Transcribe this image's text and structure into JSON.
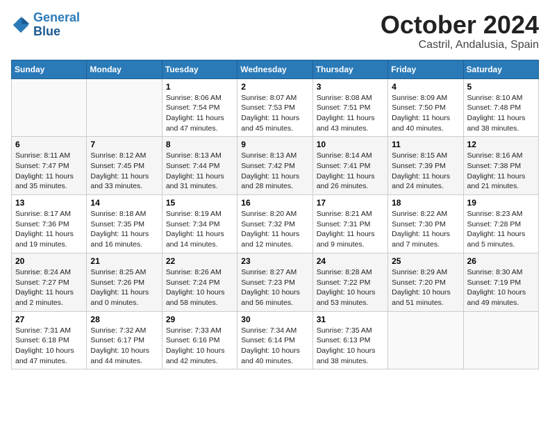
{
  "header": {
    "logo_line1": "General",
    "logo_line2": "Blue",
    "month": "October 2024",
    "location": "Castril, Andalusia, Spain"
  },
  "weekdays": [
    "Sunday",
    "Monday",
    "Tuesday",
    "Wednesday",
    "Thursday",
    "Friday",
    "Saturday"
  ],
  "weeks": [
    [
      {
        "day": "",
        "info": ""
      },
      {
        "day": "",
        "info": ""
      },
      {
        "day": "1",
        "info": "Sunrise: 8:06 AM\nSunset: 7:54 PM\nDaylight: 11 hours and 47 minutes."
      },
      {
        "day": "2",
        "info": "Sunrise: 8:07 AM\nSunset: 7:53 PM\nDaylight: 11 hours and 45 minutes."
      },
      {
        "day": "3",
        "info": "Sunrise: 8:08 AM\nSunset: 7:51 PM\nDaylight: 11 hours and 43 minutes."
      },
      {
        "day": "4",
        "info": "Sunrise: 8:09 AM\nSunset: 7:50 PM\nDaylight: 11 hours and 40 minutes."
      },
      {
        "day": "5",
        "info": "Sunrise: 8:10 AM\nSunset: 7:48 PM\nDaylight: 11 hours and 38 minutes."
      }
    ],
    [
      {
        "day": "6",
        "info": "Sunrise: 8:11 AM\nSunset: 7:47 PM\nDaylight: 11 hours and 35 minutes."
      },
      {
        "day": "7",
        "info": "Sunrise: 8:12 AM\nSunset: 7:45 PM\nDaylight: 11 hours and 33 minutes."
      },
      {
        "day": "8",
        "info": "Sunrise: 8:13 AM\nSunset: 7:44 PM\nDaylight: 11 hours and 31 minutes."
      },
      {
        "day": "9",
        "info": "Sunrise: 8:13 AM\nSunset: 7:42 PM\nDaylight: 11 hours and 28 minutes."
      },
      {
        "day": "10",
        "info": "Sunrise: 8:14 AM\nSunset: 7:41 PM\nDaylight: 11 hours and 26 minutes."
      },
      {
        "day": "11",
        "info": "Sunrise: 8:15 AM\nSunset: 7:39 PM\nDaylight: 11 hours and 24 minutes."
      },
      {
        "day": "12",
        "info": "Sunrise: 8:16 AM\nSunset: 7:38 PM\nDaylight: 11 hours and 21 minutes."
      }
    ],
    [
      {
        "day": "13",
        "info": "Sunrise: 8:17 AM\nSunset: 7:36 PM\nDaylight: 11 hours and 19 minutes."
      },
      {
        "day": "14",
        "info": "Sunrise: 8:18 AM\nSunset: 7:35 PM\nDaylight: 11 hours and 16 minutes."
      },
      {
        "day": "15",
        "info": "Sunrise: 8:19 AM\nSunset: 7:34 PM\nDaylight: 11 hours and 14 minutes."
      },
      {
        "day": "16",
        "info": "Sunrise: 8:20 AM\nSunset: 7:32 PM\nDaylight: 11 hours and 12 minutes."
      },
      {
        "day": "17",
        "info": "Sunrise: 8:21 AM\nSunset: 7:31 PM\nDaylight: 11 hours and 9 minutes."
      },
      {
        "day": "18",
        "info": "Sunrise: 8:22 AM\nSunset: 7:30 PM\nDaylight: 11 hours and 7 minutes."
      },
      {
        "day": "19",
        "info": "Sunrise: 8:23 AM\nSunset: 7:28 PM\nDaylight: 11 hours and 5 minutes."
      }
    ],
    [
      {
        "day": "20",
        "info": "Sunrise: 8:24 AM\nSunset: 7:27 PM\nDaylight: 11 hours and 2 minutes."
      },
      {
        "day": "21",
        "info": "Sunrise: 8:25 AM\nSunset: 7:26 PM\nDaylight: 11 hours and 0 minutes."
      },
      {
        "day": "22",
        "info": "Sunrise: 8:26 AM\nSunset: 7:24 PM\nDaylight: 10 hours and 58 minutes."
      },
      {
        "day": "23",
        "info": "Sunrise: 8:27 AM\nSunset: 7:23 PM\nDaylight: 10 hours and 56 minutes."
      },
      {
        "day": "24",
        "info": "Sunrise: 8:28 AM\nSunset: 7:22 PM\nDaylight: 10 hours and 53 minutes."
      },
      {
        "day": "25",
        "info": "Sunrise: 8:29 AM\nSunset: 7:20 PM\nDaylight: 10 hours and 51 minutes."
      },
      {
        "day": "26",
        "info": "Sunrise: 8:30 AM\nSunset: 7:19 PM\nDaylight: 10 hours and 49 minutes."
      }
    ],
    [
      {
        "day": "27",
        "info": "Sunrise: 7:31 AM\nSunset: 6:18 PM\nDaylight: 10 hours and 47 minutes."
      },
      {
        "day": "28",
        "info": "Sunrise: 7:32 AM\nSunset: 6:17 PM\nDaylight: 10 hours and 44 minutes."
      },
      {
        "day": "29",
        "info": "Sunrise: 7:33 AM\nSunset: 6:16 PM\nDaylight: 10 hours and 42 minutes."
      },
      {
        "day": "30",
        "info": "Sunrise: 7:34 AM\nSunset: 6:14 PM\nDaylight: 10 hours and 40 minutes."
      },
      {
        "day": "31",
        "info": "Sunrise: 7:35 AM\nSunset: 6:13 PM\nDaylight: 10 hours and 38 minutes."
      },
      {
        "day": "",
        "info": ""
      },
      {
        "day": "",
        "info": ""
      }
    ]
  ]
}
